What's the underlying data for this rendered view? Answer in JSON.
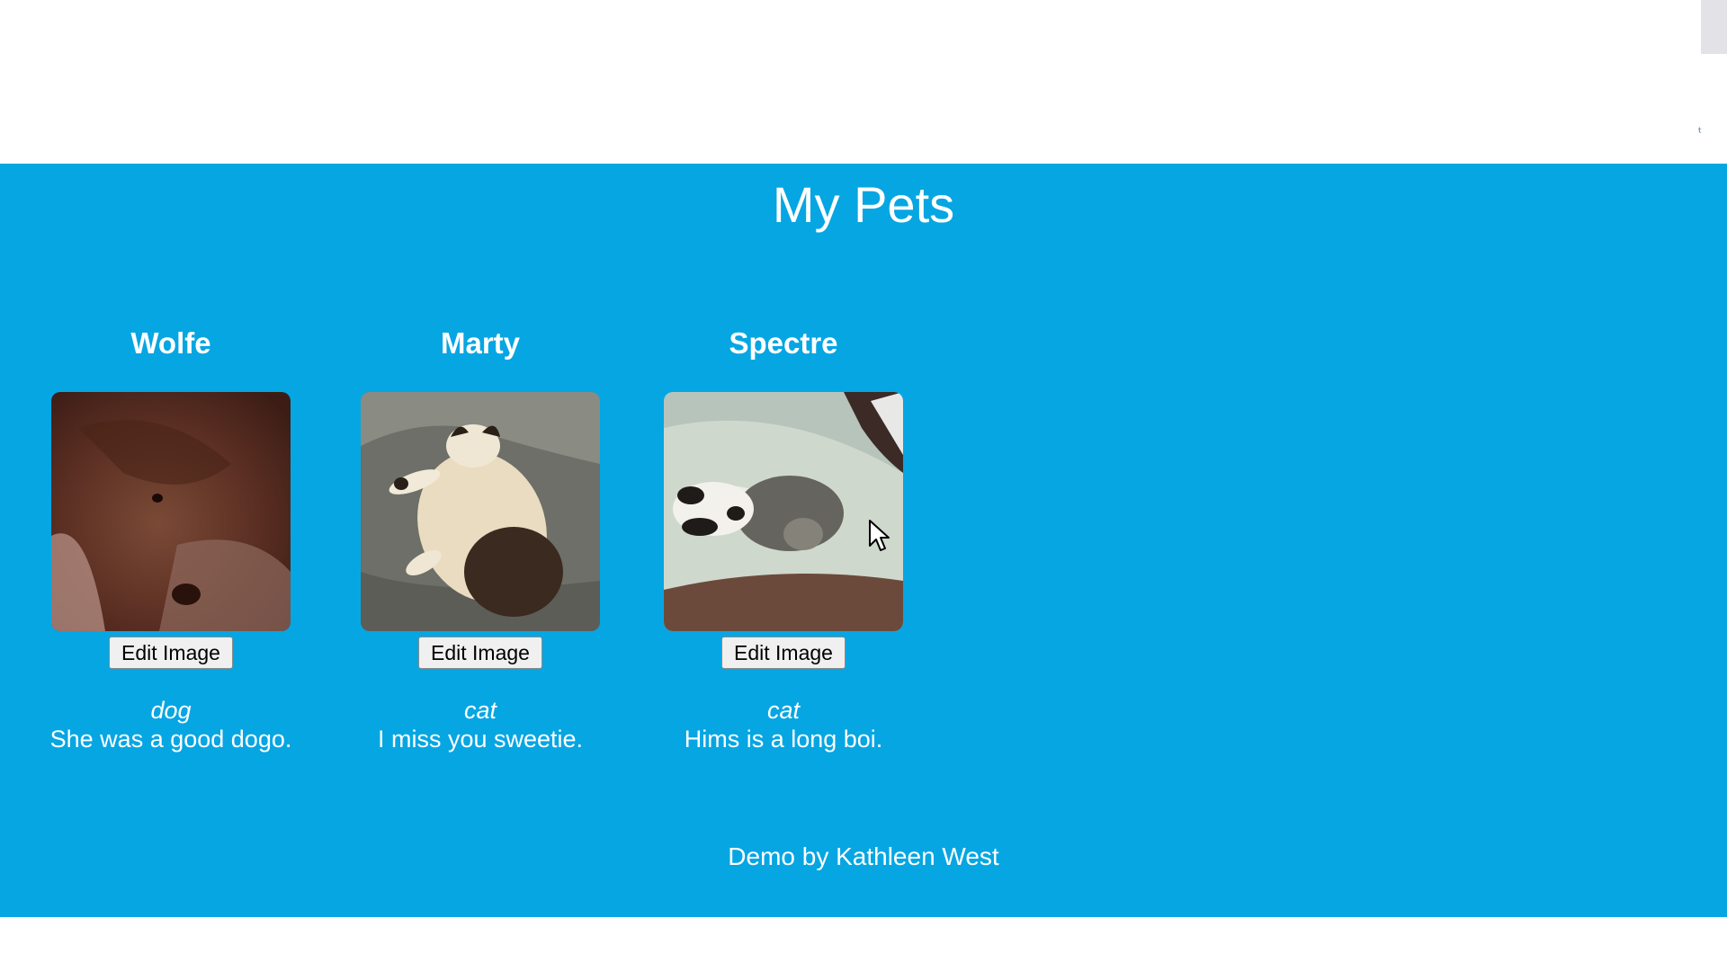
{
  "page": {
    "title": "My Pets",
    "footer": "Demo by Kathleen West"
  },
  "pets": [
    {
      "name": "Wolfe",
      "image_icon": "dog-photo",
      "button_label": "Edit Image",
      "species": "dog",
      "description": "She was a good dogo."
    },
    {
      "name": "Marty",
      "image_icon": "cat-photo",
      "button_label": "Edit Image",
      "species": "cat",
      "description": "I miss you sweetie."
    },
    {
      "name": "Spectre",
      "image_icon": "cat-photo",
      "button_label": "Edit Image",
      "species": "cat",
      "description": "Hims is a long boi."
    }
  ],
  "colors": {
    "background": "#06a6e3",
    "text": "#ffffff"
  }
}
